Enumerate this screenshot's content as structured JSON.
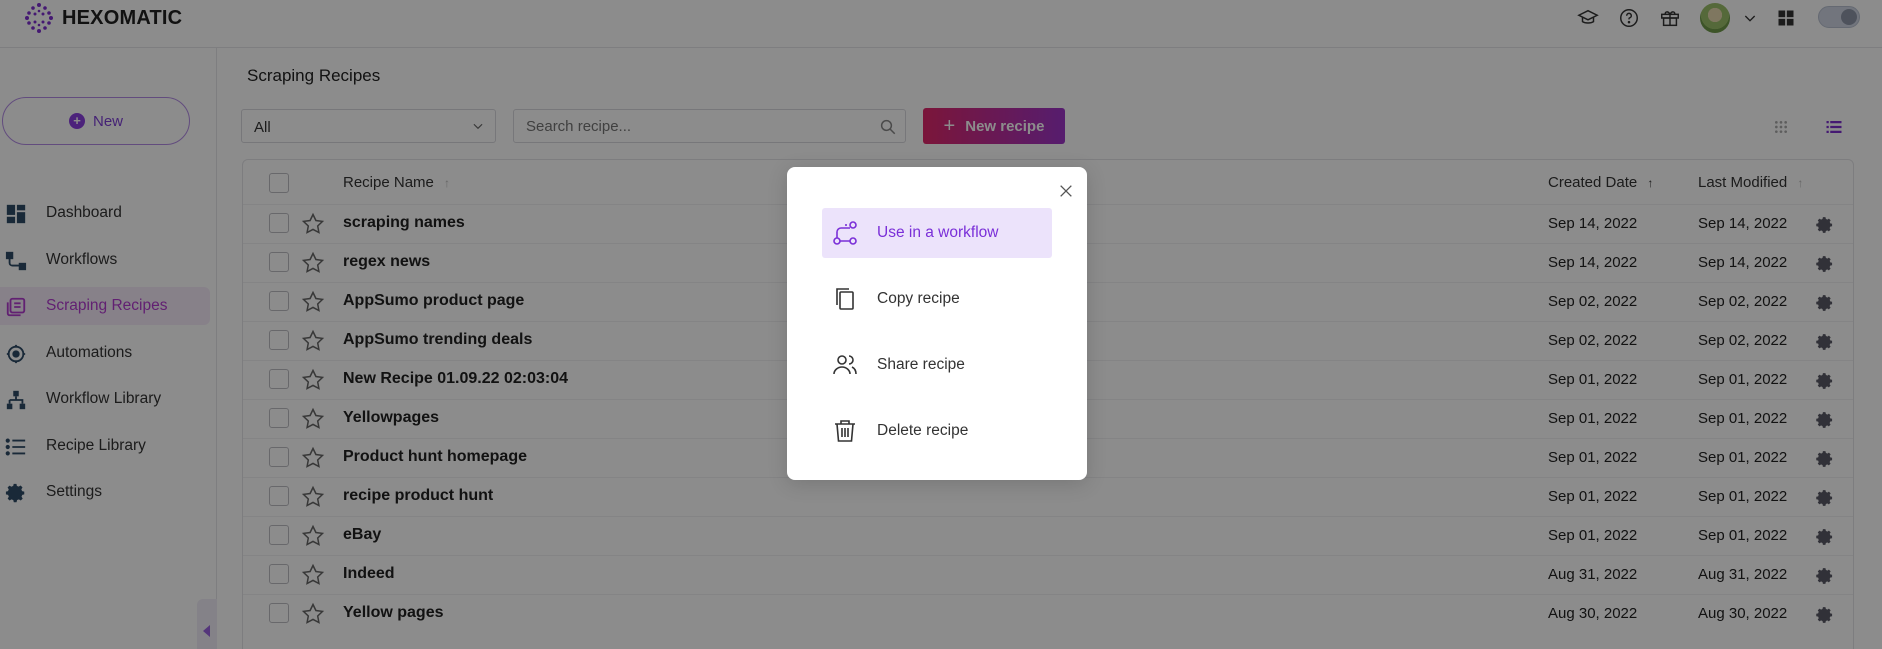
{
  "app": {
    "brand": "HEXOMATIC"
  },
  "topbar": {
    "icons": [
      "graduation-cap-icon",
      "help-circle-icon",
      "gift-icon",
      "avatar",
      "chevron-down-icon",
      "apps-grid-icon",
      "theme-toggle"
    ]
  },
  "sidebar": {
    "new_label": "New",
    "items": [
      {
        "label": "Dashboard",
        "icon": "dashboard-icon",
        "active": false
      },
      {
        "label": "Workflows",
        "icon": "workflow-icon",
        "active": false
      },
      {
        "label": "Scraping Recipes",
        "icon": "recipes-icon",
        "active": true
      },
      {
        "label": "Automations",
        "icon": "automation-icon",
        "active": false
      },
      {
        "label": "Workflow Library",
        "icon": "library-icon",
        "active": false
      },
      {
        "label": "Recipe Library",
        "icon": "list-icon",
        "active": false
      },
      {
        "label": "Settings",
        "icon": "gear-icon",
        "active": false
      }
    ]
  },
  "main": {
    "title": "Scraping Recipes",
    "filter": {
      "selected": "All"
    },
    "search": {
      "placeholder": "Search recipe...",
      "value": ""
    },
    "new_recipe_label": "New recipe",
    "table": {
      "columns": {
        "name": "Recipe Name",
        "created": "Created Date",
        "modified": "Last Modified"
      },
      "rows": [
        {
          "name": "scraping names",
          "created": "Sep 14, 2022",
          "modified": "Sep 14, 2022"
        },
        {
          "name": "regex news",
          "created": "Sep 14, 2022",
          "modified": "Sep 14, 2022"
        },
        {
          "name": "AppSumo product page",
          "created": "Sep 02, 2022",
          "modified": "Sep 02, 2022"
        },
        {
          "name": "AppSumo trending deals",
          "created": "Sep 02, 2022",
          "modified": "Sep 02, 2022"
        },
        {
          "name": "New Recipe 01.09.22 02:03:04",
          "created": "Sep 01, 2022",
          "modified": "Sep 01, 2022"
        },
        {
          "name": "Yellowpages",
          "created": "Sep 01, 2022",
          "modified": "Sep 01, 2022"
        },
        {
          "name": "Product hunt homepage",
          "created": "Sep 01, 2022",
          "modified": "Sep 01, 2022"
        },
        {
          "name": "recipe product hunt",
          "created": "Sep 01, 2022",
          "modified": "Sep 01, 2022"
        },
        {
          "name": "eBay",
          "created": "Sep 01, 2022",
          "modified": "Sep 01, 2022"
        },
        {
          "name": "Indeed",
          "created": "Aug 31, 2022",
          "modified": "Aug 31, 2022"
        },
        {
          "name": "Yellow pages",
          "created": "Aug 30, 2022",
          "modified": "Aug 30, 2022"
        }
      ]
    }
  },
  "modal": {
    "options": [
      {
        "label": "Use in a workflow",
        "icon": "workflow-icon",
        "primary": true
      },
      {
        "label": "Copy recipe",
        "icon": "copy-icon",
        "primary": false
      },
      {
        "label": "Share recipe",
        "icon": "share-users-icon",
        "primary": false
      },
      {
        "label": "Delete recipe",
        "icon": "trash-icon",
        "primary": false
      }
    ]
  },
  "colors": {
    "accent": "#8b3fe0",
    "active_nav": "#b23bd0",
    "gradient_start": "#e0276a",
    "gradient_end": "#9d35c9"
  }
}
